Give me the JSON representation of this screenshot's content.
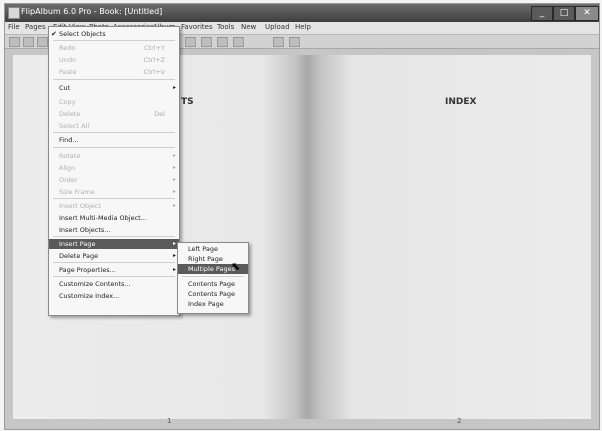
{
  "window": {
    "title": "FlipAlbum 6.0 Pro - Book: [Untitled]",
    "minimize": "_",
    "maximize": "□",
    "close": "✕"
  },
  "menubar": [
    "File",
    "Pages",
    "Edit",
    "View",
    "Photo",
    "Accessories",
    "Album",
    "Favorites",
    "Tools",
    "New",
    "Upload",
    "Help"
  ],
  "toolbar_icons": [
    "open-icon",
    "save-icon",
    "print-icon",
    "undo-icon",
    "cut-icon",
    "copy-icon",
    "paste-icon",
    "zoom-icon",
    "help-icon"
  ],
  "book": {
    "left_title": "TS",
    "right_title": "INDEX",
    "left_page_number": "1",
    "right_page_number": "2"
  },
  "pages_menu": {
    "items": [
      {
        "label": "Select Objects",
        "checked": true
      },
      {
        "label": "Redo",
        "shortcut": "Ctrl+Y",
        "disabled": true
      },
      {
        "label": "Undo",
        "shortcut": "Ctrl+Z",
        "disabled": true
      },
      {
        "label": "Paste",
        "shortcut": "Ctrl+V",
        "disabled": true
      },
      {
        "label": "Cut",
        "submenu": true
      },
      {
        "label": "Copy",
        "disabled": true
      },
      {
        "label": "Delete",
        "shortcut": "Del",
        "disabled": true
      },
      {
        "label": "Select All",
        "disabled": true
      },
      {
        "label": "Find..."
      },
      {
        "label": "Rotate",
        "disabled": true,
        "submenu": true
      },
      {
        "label": "Align",
        "disabled": true,
        "submenu": true
      },
      {
        "label": "Order",
        "disabled": true,
        "submenu": true
      },
      {
        "label": "Size Frame",
        "disabled": true,
        "submenu": true
      },
      {
        "label": "Insert Object",
        "disabled": true,
        "submenu": true
      },
      {
        "label": "Insert Multi-Media Object..."
      },
      {
        "label": "Insert Objects..."
      },
      {
        "label": "Insert Page",
        "submenu": true,
        "selected": true
      },
      {
        "label": "Delete Page",
        "submenu": true
      },
      {
        "label": "Page Properties...",
        "submenu": true
      },
      {
        "label": "Customize Contents..."
      },
      {
        "label": "Customize Index..."
      }
    ]
  },
  "insert_page_submenu": {
    "items": [
      {
        "label": "Left Page"
      },
      {
        "label": "Right Page"
      },
      {
        "label": "Multiple Pages",
        "selected": true
      },
      {
        "label": "Contents Page"
      },
      {
        "label": "Contents Page"
      },
      {
        "label": "Index Page"
      }
    ]
  },
  "colors": {
    "selection": "#5a5a5a",
    "titlebar": "#4a4a4a"
  }
}
